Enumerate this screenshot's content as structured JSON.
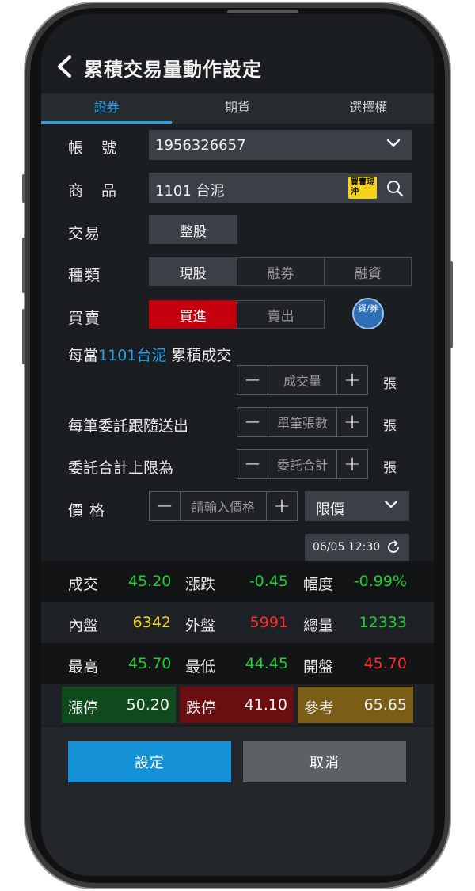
{
  "header": {
    "title": "累積交易量動作設定"
  },
  "tabs": [
    {
      "label": "證券"
    },
    {
      "label": "期貨"
    },
    {
      "label": "選擇權"
    }
  ],
  "account": {
    "label": "帳　號",
    "value": "1956326657"
  },
  "product": {
    "label": "商　品",
    "value": "1101 台泥",
    "hedge_icon_text": "買賣現沖"
  },
  "trade": {
    "label": "交易",
    "option": "整股"
  },
  "kind": {
    "label": "種類",
    "options": [
      "現股",
      "融券",
      "融資"
    ]
  },
  "side": {
    "label": "買賣",
    "buy": "買進",
    "sell": "賣出",
    "cash_icon_text": "資/券"
  },
  "condition": {
    "prefix": "每當",
    "product": "1101台泥",
    "suffix": " 累積成交"
  },
  "volume": {
    "placeholder": "成交量",
    "unit": "張"
  },
  "per_order": {
    "label": "每筆委託跟隨送出",
    "placeholder": "單筆張數",
    "unit": "張"
  },
  "total_limit": {
    "label": "委託合計上限為",
    "placeholder": "委託合計",
    "unit": "張"
  },
  "price": {
    "label": "價格",
    "placeholder": "請輸入價格",
    "type": "限價"
  },
  "timestamp": "06/05 12:30",
  "quote": {
    "row1": {
      "l1": "成交",
      "v1": "45.20",
      "l2": "漲跌",
      "v2": "-0.45",
      "l3": "幅度",
      "v3": "-0.99%"
    },
    "row2": {
      "l1": "內盤",
      "v1": "6342",
      "l2": "外盤",
      "v2": "5991",
      "l3": "總量",
      "v3": "12333"
    },
    "row3": {
      "l1": "最高",
      "v1": "45.70",
      "l2": "最低",
      "v2": "44.45",
      "l3": "開盤",
      "v3": "45.70"
    },
    "row4": {
      "l1": "漲停",
      "v1": "50.20",
      "l2": "跌停",
      "v2": "41.10",
      "l3": "參考",
      "v3": "65.65"
    }
  },
  "buttons": {
    "set": "設定",
    "cancel": "取消"
  },
  "colors": {
    "accent": "#2aa0e8",
    "up": "#ff2b2b",
    "down": "#22cc33",
    "buy": "#c4000f"
  }
}
